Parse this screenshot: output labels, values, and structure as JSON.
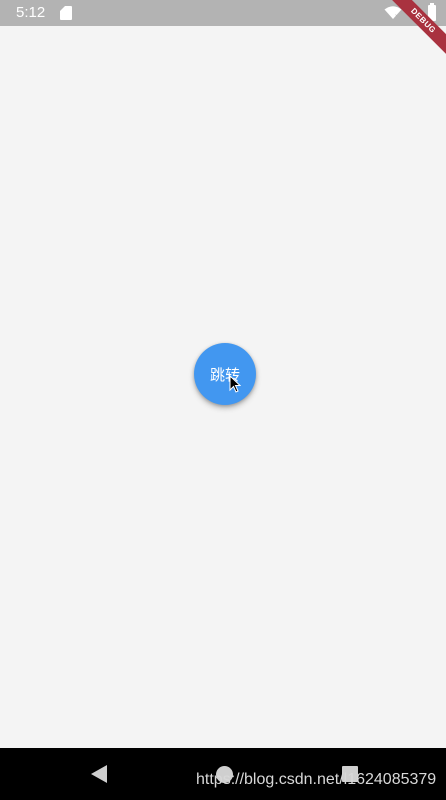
{
  "status_bar": {
    "time": "5:12",
    "icons": [
      "sd-card-icon",
      "wifi-icon",
      "battery-icon"
    ]
  },
  "debug_banner": {
    "label": "DEBUG",
    "color": "#a9323f"
  },
  "main": {
    "fab_label": "跳转",
    "fab_color": "#4297f0",
    "background": "#f4f4f4"
  },
  "nav_bar": {
    "buttons": [
      "back-icon",
      "home-icon",
      "recents-icon"
    ],
    "watermark": "https://blog.csdn.net/l1624085379"
  }
}
